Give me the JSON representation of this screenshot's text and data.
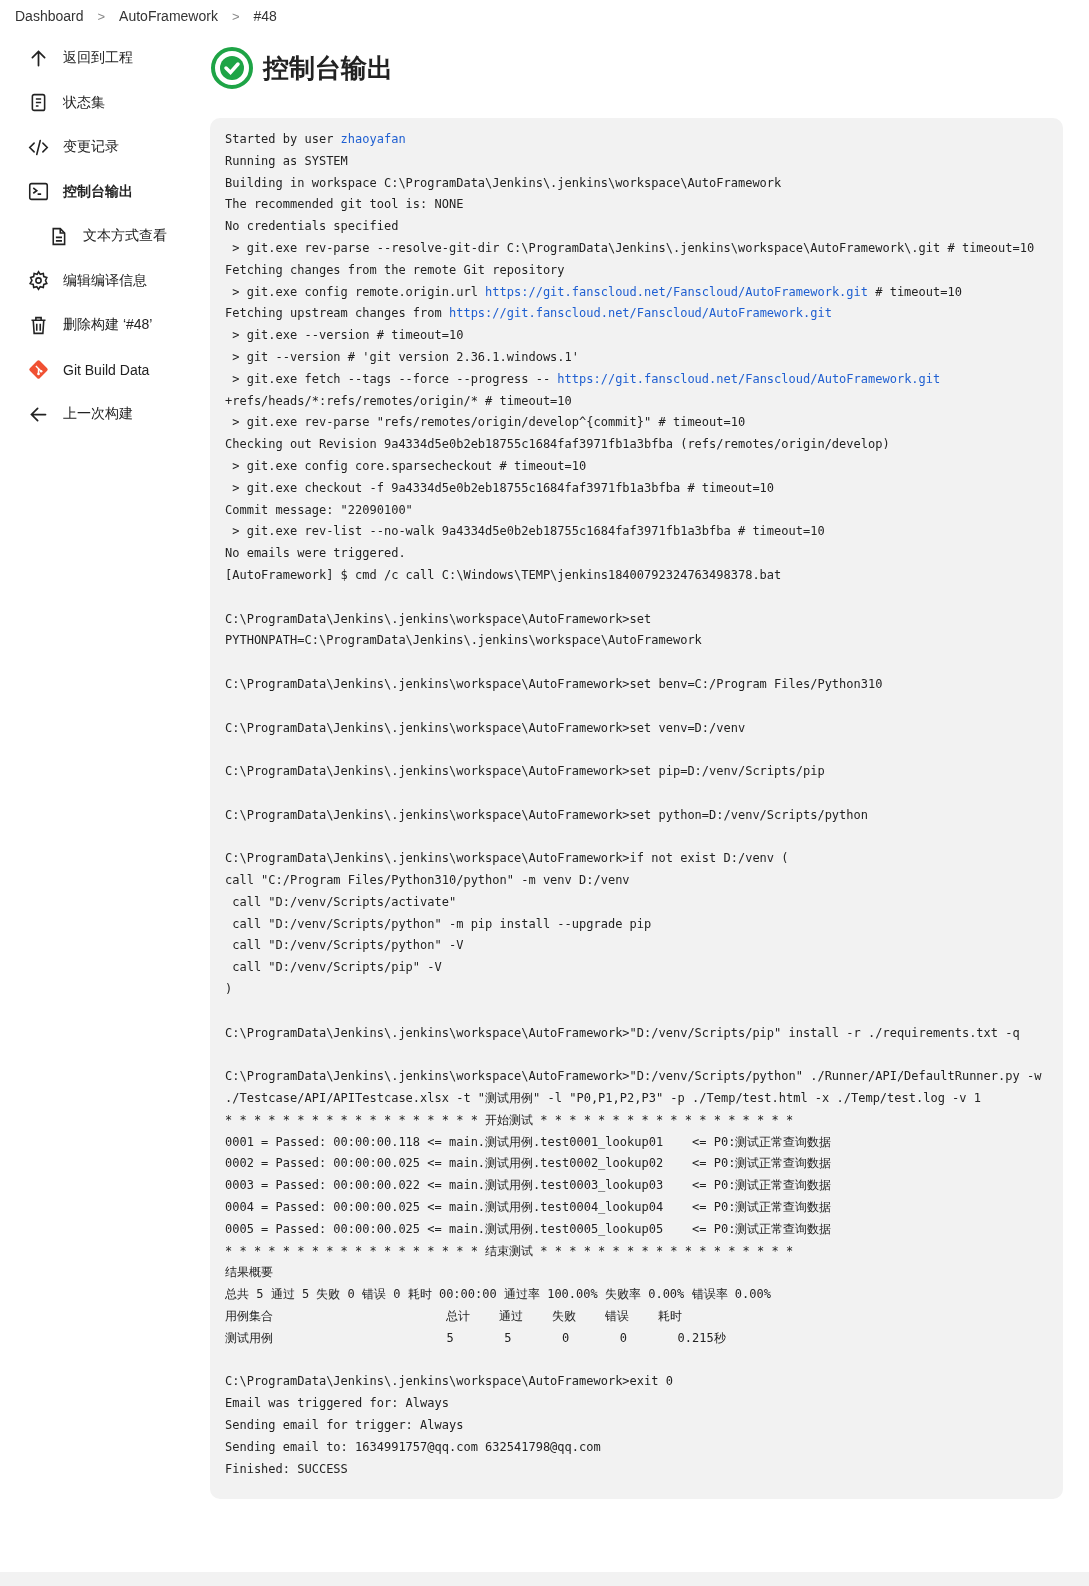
{
  "breadcrumb": [
    {
      "label": "Dashboard"
    },
    {
      "label": "AutoFramework"
    },
    {
      "label": "#48"
    }
  ],
  "breadcrumb_separator": ">",
  "sidebar": {
    "items": [
      {
        "label": "返回到工程",
        "kind": "up",
        "selected": false
      },
      {
        "label": "状态集",
        "kind": "doc",
        "selected": false
      },
      {
        "label": "变更记录",
        "kind": "code",
        "selected": false
      },
      {
        "label": "控制台输出",
        "kind": "terminal",
        "selected": true,
        "children": [
          {
            "label": "文本方式查看",
            "kind": "file",
            "selected": false
          }
        ]
      },
      {
        "label": "编辑编译信息",
        "kind": "gear",
        "selected": false
      },
      {
        "label": "删除构建 ‘#48’",
        "kind": "trash",
        "selected": false
      },
      {
        "label": "Git Build Data",
        "kind": "git",
        "selected": false
      },
      {
        "label": "上一次构建",
        "kind": "left",
        "selected": false
      }
    ]
  },
  "page": {
    "title": "控制台输出",
    "success": true
  },
  "console": {
    "blocks": [
      [
        {
          "parts": [
            {
              "text": "Started by user "
            },
            {
              "text": "zhaoyafan",
              "kind": "link"
            }
          ]
        },
        {
          "text": "Running as SYSTEM"
        },
        {
          "text": "Building in workspace C:\\ProgramData\\Jenkins\\.jenkins\\workspace\\AutoFramework"
        },
        {
          "text": "The recommended git tool is: NONE"
        },
        {
          "text": "No credentials specified"
        },
        {
          "text": " > git.exe rev-parse --resolve-git-dir C:\\ProgramData\\Jenkins\\.jenkins\\workspace\\AutoFramework\\.git # timeout=10"
        },
        {
          "text": "Fetching changes from the remote Git repository"
        },
        {
          "parts": [
            {
              "text": " > git.exe config remote.origin.url "
            },
            {
              "text": "https://git.fanscloud.net/Fanscloud/AutoFramework.git",
              "kind": "link"
            },
            {
              "text": " # timeout=10"
            }
          ]
        },
        {
          "parts": [
            {
              "text": "Fetching upstream changes from "
            },
            {
              "text": "https://git.fanscloud.net/Fanscloud/AutoFramework.git",
              "kind": "link"
            }
          ]
        },
        {
          "text": " > git.exe --version # timeout=10"
        },
        {
          "text": " > git --version # 'git version 2.36.1.windows.1'"
        },
        {
          "parts": [
            {
              "text": " > git.exe fetch --tags --force --progress -- "
            },
            {
              "text": "https://git.fanscloud.net/Fanscloud/AutoFramework.git",
              "kind": "link"
            }
          ]
        },
        {
          "text": "+refs/heads/*:refs/remotes/origin/* # timeout=10"
        },
        {
          "text": " > git.exe rev-parse \"refs/remotes/origin/develop^{commit}\" # timeout=10"
        },
        {
          "text": "Checking out Revision 9a4334d5e0b2eb18755c1684faf3971fb1a3bfba (refs/remotes/origin/develop)"
        },
        {
          "text": " > git.exe config core.sparsecheckout # timeout=10"
        },
        {
          "text": " > git.exe checkout -f 9a4334d5e0b2eb18755c1684faf3971fb1a3bfba # timeout=10"
        },
        {
          "text": "Commit message: \"22090100\""
        },
        {
          "text": " > git.exe rev-list --no-walk 9a4334d5e0b2eb18755c1684faf3971fb1a3bfba # timeout=10"
        },
        {
          "text": "No emails were triggered."
        },
        {
          "text": "[AutoFramework] $ cmd /c call C:\\Windows\\TEMP\\jenkins18400792324763498378.bat"
        }
      ],
      [
        {
          "text": "C:\\ProgramData\\Jenkins\\.jenkins\\workspace\\AutoFramework>set"
        },
        {
          "text": "PYTHONPATH=C:\\ProgramData\\Jenkins\\.jenkins\\workspace\\AutoFramework"
        }
      ],
      [
        {
          "text": "C:\\ProgramData\\Jenkins\\.jenkins\\workspace\\AutoFramework>set benv=C:/Program Files/Python310"
        }
      ],
      [
        {
          "text": "C:\\ProgramData\\Jenkins\\.jenkins\\workspace\\AutoFramework>set venv=D:/venv"
        }
      ],
      [
        {
          "text": "C:\\ProgramData\\Jenkins\\.jenkins\\workspace\\AutoFramework>set pip=D:/venv/Scripts/pip"
        }
      ],
      [
        {
          "text": "C:\\ProgramData\\Jenkins\\.jenkins\\workspace\\AutoFramework>set python=D:/venv/Scripts/python"
        }
      ],
      [
        {
          "text": "C:\\ProgramData\\Jenkins\\.jenkins\\workspace\\AutoFramework>if not exist D:/venv ("
        },
        {
          "text": "call \"C:/Program Files/Python310/python\" -m venv D:/venv"
        },
        {
          "text": " call \"D:/venv/Scripts/activate\""
        },
        {
          "text": " call \"D:/venv/Scripts/python\" -m pip install --upgrade pip"
        },
        {
          "text": " call \"D:/venv/Scripts/python\" -V"
        },
        {
          "text": " call \"D:/venv/Scripts/pip\" -V"
        },
        {
          "text": ")"
        }
      ],
      [
        {
          "text": "C:\\ProgramData\\Jenkins\\.jenkins\\workspace\\AutoFramework>\"D:/venv/Scripts/pip\" install -r ./requirements.txt -q"
        }
      ],
      [
        {
          "text": "C:\\ProgramData\\Jenkins\\.jenkins\\workspace\\AutoFramework>\"D:/venv/Scripts/python\" ./Runner/API/DefaultRunner.py -w"
        },
        {
          "text": "./Testcase/API/APITestcase.xlsx -t \"测试用例\" -l \"P0,P1,P2,P3\" -p ./Temp/test.html -x ./Temp/test.log -v 1"
        },
        {
          "text": "* * * * * * * * * * * * * * * * * * 开始测试 * * * * * * * * * * * * * * * * * *"
        },
        {
          "text": "0001 = Passed: 00:00:00.118 <= main.测试用例.test0001_lookup01    <= P0:测试正常查询数据"
        },
        {
          "text": "0002 = Passed: 00:00:00.025 <= main.测试用例.test0002_lookup02    <= P0:测试正常查询数据"
        },
        {
          "text": "0003 = Passed: 00:00:00.022 <= main.测试用例.test0003_lookup03    <= P0:测试正常查询数据"
        },
        {
          "text": "0004 = Passed: 00:00:00.025 <= main.测试用例.test0004_lookup04    <= P0:测试正常查询数据"
        },
        {
          "text": "0005 = Passed: 00:00:00.025 <= main.测试用例.test0005_lookup05    <= P0:测试正常查询数据"
        },
        {
          "text": "* * * * * * * * * * * * * * * * * * 结束测试 * * * * * * * * * * * * * * * * * *"
        },
        {
          "text": "结果概要"
        },
        {
          "text": "总共 5 通过 5 失败 0 错误 0 耗时 00:00:00 通过率 100.00% 失败率 0.00% 错误率 0.00%"
        },
        {
          "text": "用例集合                        总计    通过    失败    错误    耗时"
        },
        {
          "text": "测试用例                        5       5       0       0       0.215秒"
        }
      ],
      [
        {
          "text": "C:\\ProgramData\\Jenkins\\.jenkins\\workspace\\AutoFramework>exit 0"
        },
        {
          "text": "Email was triggered for: Always"
        },
        {
          "text": "Sending email for trigger: Always"
        },
        {
          "text": "Sending email to: 1634991757@qq.com 632541798@qq.com"
        },
        {
          "text": "Finished: SUCCESS"
        }
      ]
    ]
  }
}
